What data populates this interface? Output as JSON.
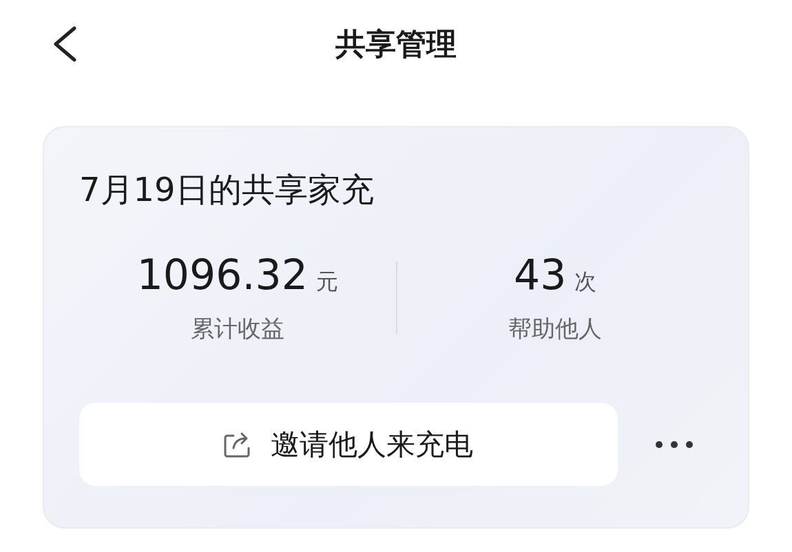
{
  "header": {
    "title": "共享管理"
  },
  "card": {
    "title": "7月19日的共享家充",
    "stats": [
      {
        "value": "1096.32",
        "unit": "元",
        "label": "累计收益"
      },
      {
        "value": "43",
        "unit": "次",
        "label": "帮助他人"
      }
    ],
    "invite_button": {
      "label": "邀请他人来充电"
    }
  }
}
